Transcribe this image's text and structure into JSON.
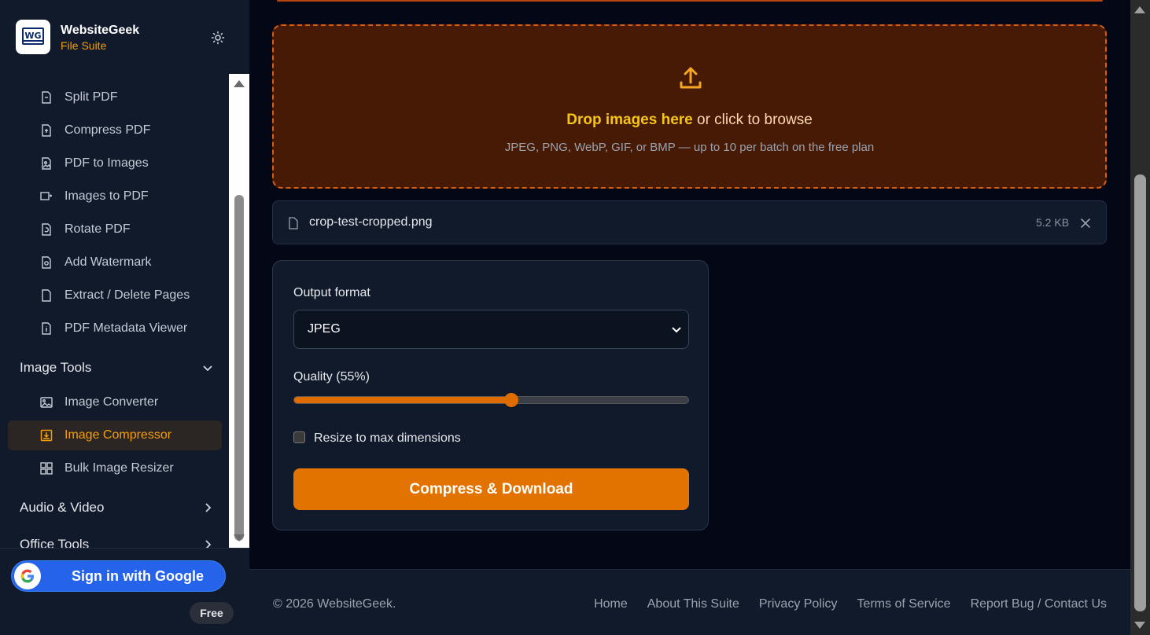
{
  "brand": {
    "name": "WebsiteGeek",
    "subtitle": "File Suite",
    "logo_text": "WG"
  },
  "sidebar": {
    "pdf_items": [
      {
        "label": "Split PDF",
        "icon": "file-split-icon"
      },
      {
        "label": "Compress PDF",
        "icon": "file-compress-icon"
      },
      {
        "label": "PDF to Images",
        "icon": "file-image-icon"
      },
      {
        "label": "Images to PDF",
        "icon": "images-to-pdf-icon"
      },
      {
        "label": "Rotate PDF",
        "icon": "file-rotate-icon"
      },
      {
        "label": "Add Watermark",
        "icon": "file-watermark-icon"
      },
      {
        "label": "Extract / Delete Pages",
        "icon": "file-extract-icon"
      },
      {
        "label": "PDF Metadata Viewer",
        "icon": "file-info-icon"
      }
    ],
    "image_section": "Image Tools",
    "image_items": [
      {
        "label": "Image Converter",
        "icon": "image-icon"
      },
      {
        "label": "Image Compressor",
        "icon": "image-compress-icon"
      },
      {
        "label": "Bulk Image Resizer",
        "icon": "grid-icon"
      }
    ],
    "audio_section": "Audio & Video",
    "office_section": "Office Tools",
    "google_button": "Sign in with Google",
    "plan_badge": "Free"
  },
  "dropzone": {
    "title_bold": "Drop images here",
    "title_rest": " or click to browse",
    "subtitle": "JPEG, PNG, WebP, GIF, or BMP — up to 10 per batch on the free plan"
  },
  "file": {
    "name": "crop-test-cropped.png",
    "size": "5.2 KB"
  },
  "settings": {
    "output_label": "Output format",
    "output_value": "JPEG",
    "quality_label": "Quality (55%)",
    "quality_value": 55,
    "resize_label": "Resize to max dimensions",
    "resize_checked": false,
    "action_button": "Compress & Download"
  },
  "footer": {
    "copyright": "© 2026 WebsiteGeek.",
    "links": [
      "Home",
      "About This Suite",
      "Privacy Policy",
      "Terms of Service",
      "Report Bug / Contact Us"
    ]
  },
  "colors": {
    "accent": "#e27300",
    "highlight": "#f5c518",
    "active_text": "#f59e0b",
    "google_blue": "#2563eb"
  }
}
